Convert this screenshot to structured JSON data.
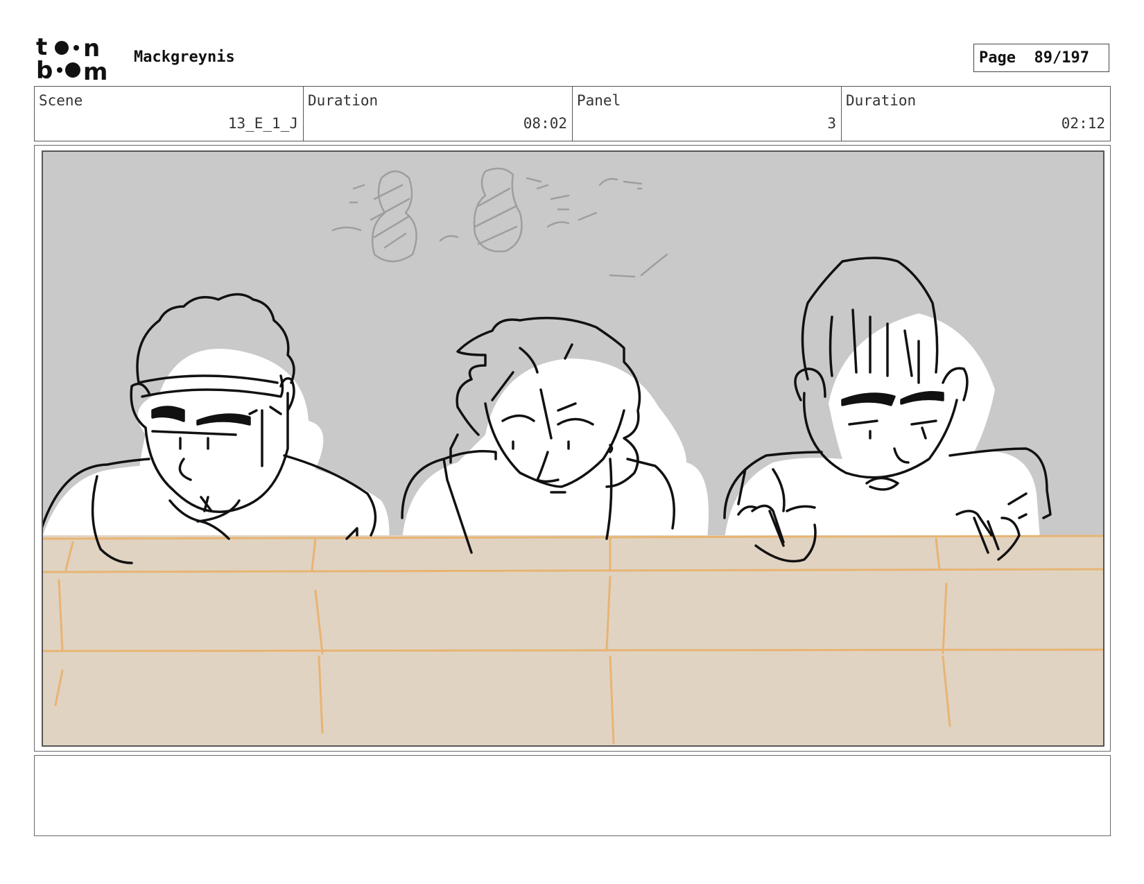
{
  "header": {
    "logo_text_top": "toon",
    "logo_text_bottom": "boom",
    "project_name": "Mackgreynis",
    "page_label": "Page",
    "page_number": "89/197"
  },
  "info": {
    "scene_label": "Scene",
    "scene_value": "13_E_1_J",
    "scene_duration_label": "Duration",
    "scene_duration_value": "08:02",
    "panel_label": "Panel",
    "panel_value": "3",
    "panel_duration_label": "Duration",
    "panel_duration_value": "02:12"
  },
  "artwork": {
    "description_icon": "storyboard-sketch",
    "colors": {
      "background": "#c9c9c9",
      "wall": "#e0d3c2",
      "wall_lines": "#e8b473",
      "ink": "#111111"
    }
  },
  "caption": {
    "text": ""
  }
}
